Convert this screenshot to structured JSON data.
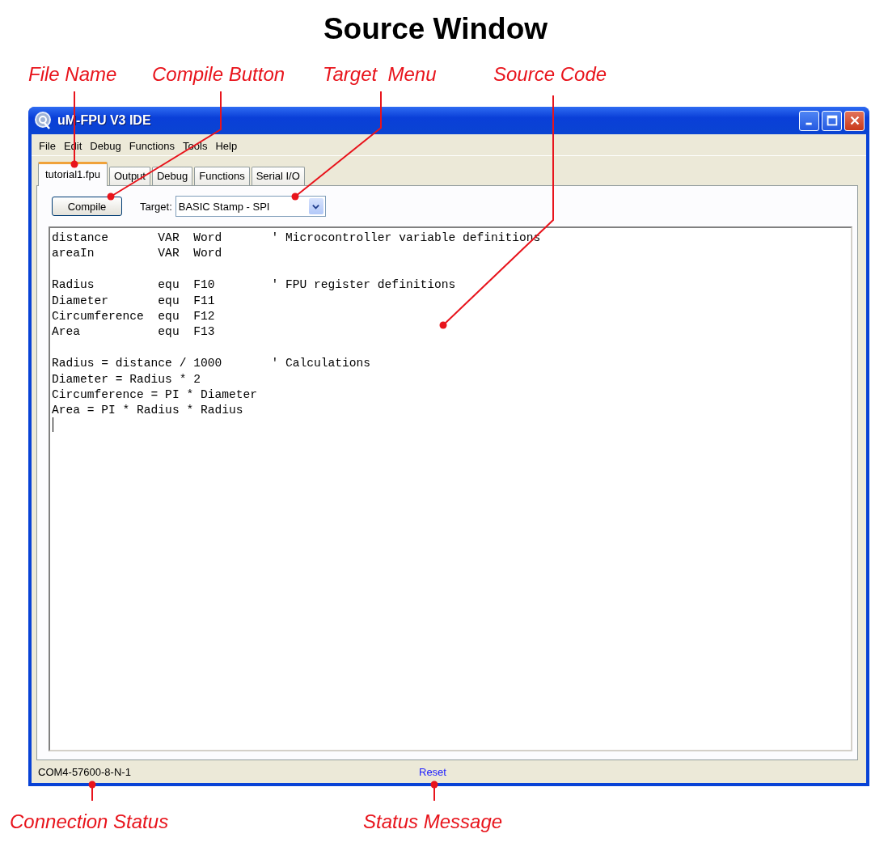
{
  "heading": "Source Window",
  "annotations": [
    {
      "kind": "file",
      "label": "File Name"
    },
    {
      "kind": "compile",
      "label": "Compile Button"
    },
    {
      "kind": "target",
      "label": "Target  Menu"
    },
    {
      "kind": "source",
      "label": "Source Code"
    },
    {
      "kind": "connection",
      "label": "Connection Status"
    },
    {
      "kind": "message",
      "label": "Status Message"
    }
  ],
  "window": {
    "title": "uM-FPU V3 IDE"
  },
  "menu": [
    "File",
    "Edit",
    "Debug",
    "Functions",
    "Tools",
    "Help"
  ],
  "tabs": [
    {
      "label": "tutorial1.fpu",
      "selected": true
    },
    {
      "label": "Output",
      "selected": false
    },
    {
      "label": "Debug",
      "selected": false
    },
    {
      "label": "Functions",
      "selected": false
    },
    {
      "label": "Serial I/O",
      "selected": false
    }
  ],
  "toolbar": {
    "compile_button": "Compile",
    "target_label": "Target:",
    "target_value": "BASIC Stamp - SPI"
  },
  "source_code": "distance       VAR  Word       ' Microcontroller variable definitions\nareaIn         VAR  Word\n\nRadius         equ  F10        ' FPU register definitions\nDiameter       equ  F11\nCircumference  equ  F12\nArea           equ  F13\n\nRadius = distance / 1000       ' Calculations\nDiameter = Radius * 2\nCircumference = PI * Diameter\nArea = PI * Radius * Radius\n",
  "status_bar": {
    "connection": "COM4-57600-8-N-1",
    "message": "Reset"
  }
}
